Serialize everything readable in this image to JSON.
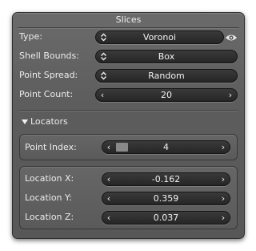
{
  "panel": {
    "title": "Slices"
  },
  "settings": {
    "type": {
      "label": "Type:",
      "value": "Voronoi",
      "icon": "eye-icon"
    },
    "shell_bounds": {
      "label": "Shell Bounds:",
      "value": "Box"
    },
    "point_spread": {
      "label": "Point Spread:",
      "value": "Random"
    },
    "point_count": {
      "label": "Point Count:",
      "value": "20"
    }
  },
  "locators": {
    "header": "Locators",
    "point_index": {
      "label": "Point Index:",
      "value": "4",
      "fill_fraction": 0.1
    },
    "location_x": {
      "label": "Location X:",
      "value": "-0.162"
    },
    "location_y": {
      "label": "Location Y:",
      "value": "0.359"
    },
    "location_z": {
      "label": "Location Z:",
      "value": "0.037"
    }
  }
}
